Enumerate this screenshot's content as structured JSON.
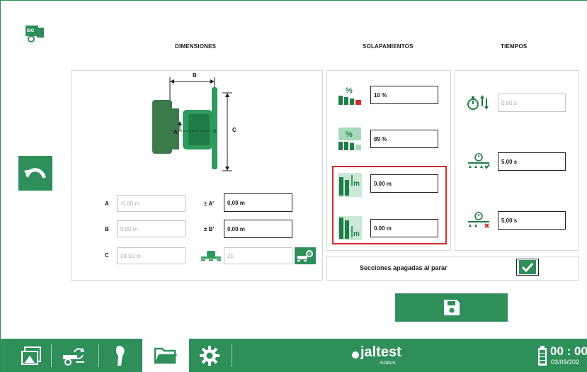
{
  "app": {
    "logo_text": "ISO"
  },
  "headers": {
    "dimensiones": "DIMENSIONES",
    "solapamientos": "SOLAPAMIENTOS",
    "tiempos": "TIEMPOS"
  },
  "diagram": {
    "b_label": "B",
    "c_label": "C",
    "a_label": "A"
  },
  "dimensions": {
    "a_label": "A",
    "a_value": "-0.00 m",
    "b_label": "B",
    "b_value": "5.00 m",
    "c_label": "C",
    "c_value": "24.50 m",
    "a_prime_label": "± A'",
    "a_prime_value": "0.00 m",
    "b_prime_label": "± B'",
    "b_prime_value": "0.00 m",
    "sections_value": "21"
  },
  "overlaps": {
    "overlap1_value": "10 %",
    "overlap2_value": "89 %",
    "dist1_value": "0.00 m",
    "dist2_value": "0.00 m",
    "percent_symbol": "%",
    "meter_symbol": "m"
  },
  "times": {
    "time1_value": "0.00 s",
    "time2_value": "5.00 s",
    "time3_value": "5.00 s"
  },
  "sections_off": {
    "label": "Secciones apagadas al parar",
    "checked": true
  },
  "status": {
    "brand": "jaltest",
    "brand_sub": "ISOBUS",
    "clock": "00 : 00",
    "date": "03/09/202"
  },
  "colors": {
    "accent": "#2f8f5b",
    "highlight": "#d62b2b",
    "border": "#d8d8d8"
  }
}
